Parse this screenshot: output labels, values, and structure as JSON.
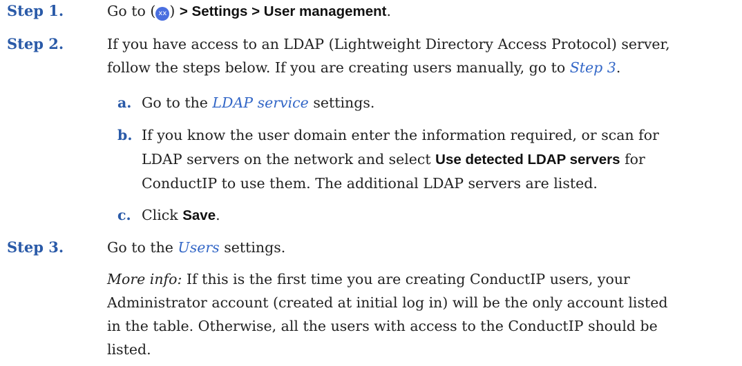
{
  "steps": {
    "s1": {
      "label": "Step 1.",
      "t_before": "Go to (",
      "icon": "xx",
      "t_after": ") ",
      "path": "> Settings > User management",
      "t_end": "."
    },
    "s2": {
      "label": "Step 2.",
      "line1": "If you have access to an LDAP (Lightweight Directory Access Protocol) server,",
      "line2_before": "follow the steps below. If you are creating users manually, go to ",
      "line2_link": "Step 3",
      "line2_end": ".",
      "subs": {
        "a": {
          "letter": "a.",
          "before": "Go to the ",
          "link": "LDAP service",
          "after": " settings."
        },
        "b": {
          "letter": "b.",
          "line1": "If you know the user domain enter the information required, or scan for",
          "line2_before": "LDAP servers on the network and select ",
          "line2_bold": "Use detected LDAP servers",
          "line2_after": " for",
          "line3": "ConductIP to use them. The additional LDAP servers are listed."
        },
        "c": {
          "letter": "c.",
          "before": "Click ",
          "bold": "Save",
          "after": "."
        }
      }
    },
    "s3": {
      "label": "Step 3.",
      "before": "Go to the ",
      "link": "Users",
      "after": " settings.",
      "more_label": "More info:",
      "more_line1": " If this is the first time you are creating ConductIP users, your",
      "more_line2": "Administrator account (created at initial log in) will be the only account listed",
      "more_line3": "in the table. Otherwise, all the users with access to the ConductIP should be",
      "more_line4": "listed."
    }
  },
  "colors": {
    "step_label": "#2a5aa8",
    "link": "#3367c7",
    "icon_bg": "#4a6fe0"
  }
}
